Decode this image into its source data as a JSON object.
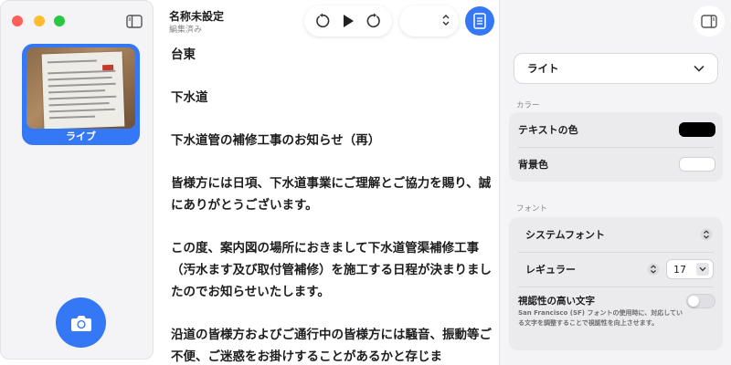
{
  "window": {
    "traffic_lights": [
      "close",
      "minimize",
      "zoom"
    ]
  },
  "sidebar": {
    "thumbnail": {
      "label": "ライブ"
    },
    "colors": {
      "accent": "#3478f6"
    }
  },
  "header": {
    "title": "名称未設定",
    "subtitle": "編集済み",
    "select_value": ""
  },
  "document": {
    "paragraphs": [
      "台東",
      "下水道",
      "下水道管の補修工事のお知らせ（再）",
      "皆様方には日項、下水道事業にご理解とご協力を賜り、誠にありがとうございます。",
      "この度、案内図の場所におきまして下水道管渠補修工事（汚水ます及び取付管補修）を施工する日程が決まりましたのでお知らせいたします。",
      "沿道の皆様方およびご通行中の皆様方には騒音、振動等ご不便、ご迷惑をお掛けすることがあるかと存じま"
    ]
  },
  "inspector": {
    "theme": "ライト",
    "color_section": "カラー",
    "text_color_label": "テキストの色",
    "text_color": "#000000",
    "background_label": "背景色",
    "background_color": "#ffffff",
    "font_section": "フォント",
    "font_family": "システムフォント",
    "font_weight": "レギュラー",
    "font_size": "17",
    "legibility_title": "視認性の高い文字",
    "legibility_desc": "San Francisco (SF) フォントの使用時に、対応している文字を調整することで視認性を向上させます。",
    "legibility_enabled": false
  }
}
